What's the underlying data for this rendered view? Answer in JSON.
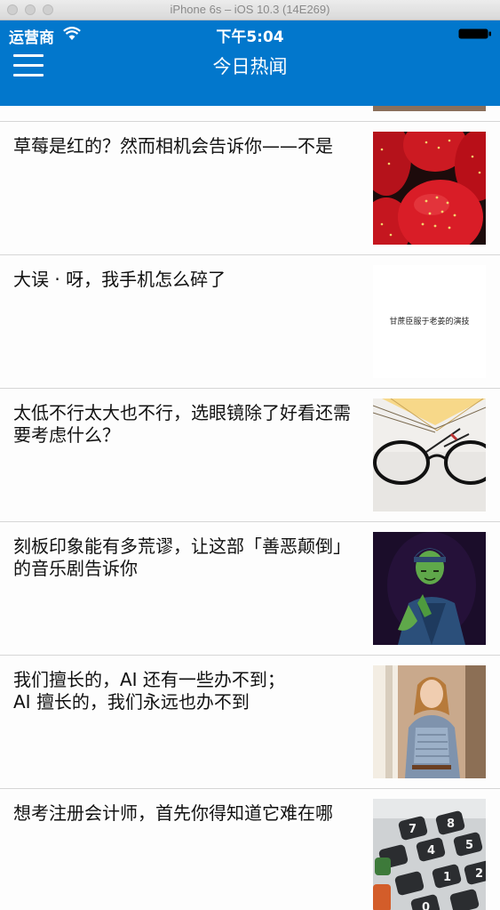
{
  "simulator": {
    "title": "iPhone 6s – iOS 10.3 (14E269)"
  },
  "status_bar": {
    "carrier": "运营商",
    "time": "下午5:04"
  },
  "header": {
    "title": "今日热闻",
    "menu_icon": "hamburger-menu-icon"
  },
  "colors": {
    "header_bg": "#0277cc",
    "header_text": "#ffffff"
  },
  "news": [
    {
      "title": "草莓是红的？然而相机会告诉你——不是",
      "image": "strawberries"
    },
    {
      "title": "大误 · 呀，我手机怎么碎了",
      "image": "text-card",
      "image_caption": "甘蔗臣服于老姜的演技"
    },
    {
      "title": "太低不行太大也不行，选眼镜除了好看还需要考虑什么？",
      "image": "glasses-on-book"
    },
    {
      "title": "刻板印象能有多荒谬，让这部「善恶颠倒」的音乐剧告诉你",
      "image": "green-witch-on-stage"
    },
    {
      "title": "我们擅长的，AI 还有一些办不到；\nAI 擅长的，我们永远也办不到",
      "image": "woman-in-dress"
    },
    {
      "title": "想考注册会计师，首先你得知道它难在哪",
      "image": "calculator-keys"
    }
  ]
}
